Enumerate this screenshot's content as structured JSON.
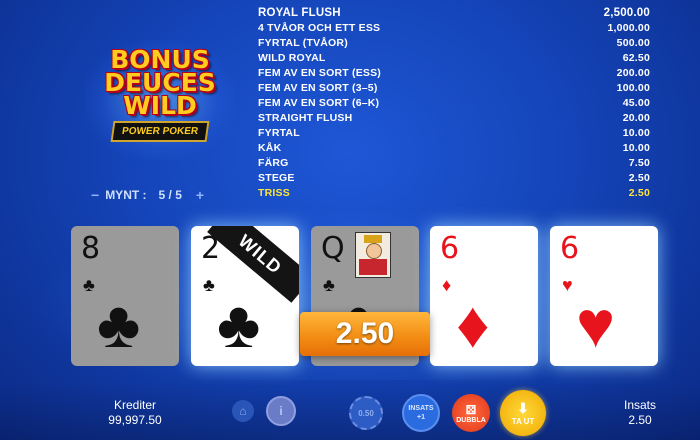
{
  "logo": {
    "line1": "BONUS",
    "line2": "DEUCES",
    "line3": "WILD",
    "subtitle": "POWER POKER"
  },
  "coins": {
    "label": "MYNT :",
    "value": "5 / 5",
    "minus": "−",
    "plus": "+"
  },
  "paytable": [
    {
      "hand": "ROYAL FLUSH",
      "payout": "2,500.00",
      "highlight": false
    },
    {
      "hand": "4 TVÅOR OCH ETT ESS",
      "payout": "1,000.00",
      "highlight": false
    },
    {
      "hand": "FYRTAL (TVÅOR)",
      "payout": "500.00",
      "highlight": false
    },
    {
      "hand": "WILD ROYAL",
      "payout": "62.50",
      "highlight": false
    },
    {
      "hand": "FEM AV EN SORT (ESS)",
      "payout": "200.00",
      "highlight": false
    },
    {
      "hand": "FEM AV EN SORT (3–5)",
      "payout": "100.00",
      "highlight": false
    },
    {
      "hand": "FEM AV EN SORT (6–K)",
      "payout": "45.00",
      "highlight": false
    },
    {
      "hand": "STRAIGHT FLUSH",
      "payout": "20.00",
      "highlight": false
    },
    {
      "hand": "FYRTAL",
      "payout": "10.00",
      "highlight": false
    },
    {
      "hand": "KÅK",
      "payout": "10.00",
      "highlight": false
    },
    {
      "hand": "FÄRG",
      "payout": "7.50",
      "highlight": false
    },
    {
      "hand": "STEGE",
      "payout": "2.50",
      "highlight": false
    },
    {
      "hand": "TRISS",
      "payout": "2.50",
      "highlight": true
    }
  ],
  "cards": [
    {
      "rank": "8",
      "suit": "♣",
      "color": "black",
      "held": false
    },
    {
      "rank": "2",
      "suit": "♣",
      "color": "black",
      "held": true,
      "wild_label": "WILD"
    },
    {
      "rank": "Q",
      "suit": "♣",
      "color": "black",
      "held": false
    },
    {
      "rank": "6",
      "suit": "♦",
      "color": "red",
      "held": true
    },
    {
      "rank": "6",
      "suit": "♥",
      "color": "red",
      "held": true
    }
  ],
  "win_amount": "2.50",
  "footer": {
    "credits_label": "Krediter",
    "credits_value": "99,997.50",
    "bet_label": "Insats",
    "bet_value": "2.50",
    "coin_value": "0.50",
    "insats_btn": "INSATS",
    "insats_sub": "+1",
    "dubbla_btn": "DUBBLA",
    "taut_btn": "TA UT",
    "info_label": "i"
  },
  "icons": {
    "home": "home-icon",
    "info": "info-icon",
    "coin": "coin-icon",
    "dice": "dice-icon",
    "download": "download-icon"
  },
  "colors": {
    "highlight": "#ffe53a",
    "win_orange": "#f28b12",
    "background": "#1444b8"
  }
}
